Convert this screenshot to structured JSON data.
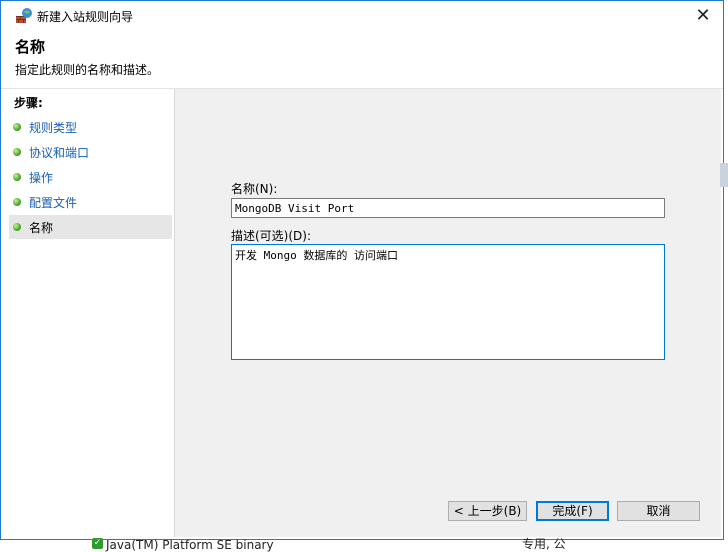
{
  "window": {
    "title": "新建入站规则向导",
    "close_glyph": "✕"
  },
  "header": {
    "title": "名称",
    "description": "指定此规则的名称和描述。"
  },
  "steps": {
    "heading": "步骤:",
    "items": [
      {
        "label": "规则类型"
      },
      {
        "label": "协议和端口"
      },
      {
        "label": "操作"
      },
      {
        "label": "配置文件"
      },
      {
        "label": "名称"
      }
    ],
    "active_index": 4
  },
  "form": {
    "name_label": "名称(N):",
    "name_value": "MongoDB Visit Port",
    "desc_label": "描述(可选)(D):",
    "desc_value": "开发 Mongo 数据库的 访问端口"
  },
  "buttons": {
    "back": "< 上一步(B)",
    "finish": "完成(F)",
    "cancel": "取消"
  },
  "background": {
    "row_text": "Java(TM) Platform SE binary",
    "row_right": "专用, 公"
  },
  "colors": {
    "accent": "#0078d7",
    "step_link": "#1a5fb4",
    "content_bg": "#f0f0f0"
  }
}
